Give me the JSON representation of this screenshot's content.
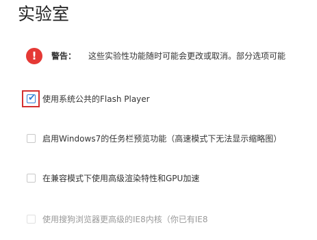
{
  "page": {
    "title": "实验室"
  },
  "warning": {
    "label": "警告：",
    "text": "这些实验性功能随时可能会更改或取消。部分选项可能",
    "icon": "exclamation-icon",
    "color": "#e53935"
  },
  "options": [
    {
      "label": "使用系统公共的Flash Player",
      "checked": true,
      "disabled": false
    },
    {
      "label": "启用Windows7的任务栏预览功能（高速模式下无法显示缩略图）",
      "checked": false,
      "disabled": false
    },
    {
      "label": "在兼容模式下使用高级渲染特性和GPU加速",
      "checked": false,
      "disabled": false
    },
    {
      "label": "使用搜狗浏览器更高级的IE8内核（你已有IE8",
      "checked": false,
      "disabled": true
    }
  ],
  "colors": {
    "accent": "#2f7fd6",
    "highlight": "#d32f2f"
  }
}
